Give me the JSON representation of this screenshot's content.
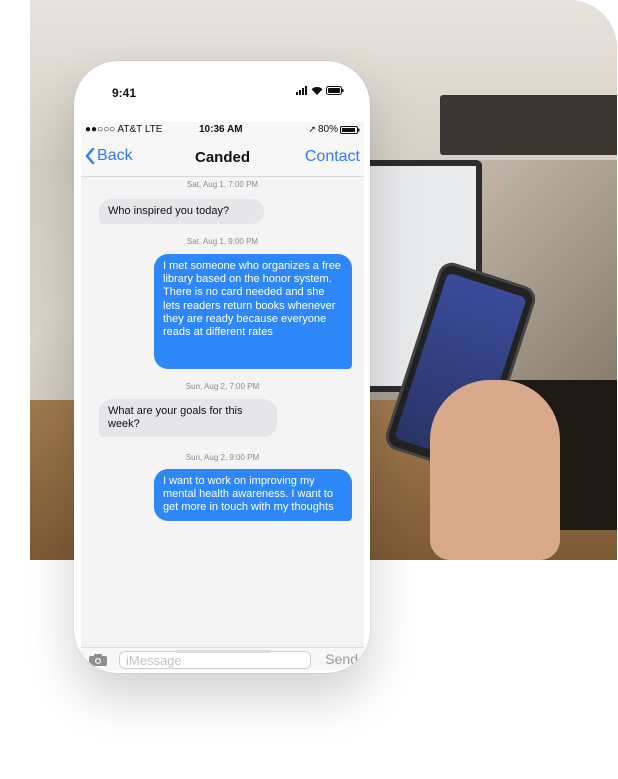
{
  "phone": {
    "time": "9:41"
  },
  "inner_status": {
    "carrier": "●●○○○ AT&T LTE",
    "time": "10:36 AM",
    "battery": "80%"
  },
  "navbar": {
    "back_label": "Back",
    "title": "Canded",
    "contact_label": "Contact"
  },
  "messages": [
    {
      "type": "timestamp",
      "text": "Sat, Aug 1, 7:00 PM"
    },
    {
      "type": "received",
      "text": "Who inspired you today?"
    },
    {
      "type": "timestamp",
      "text": "Sat, Aug 1, 9:00 PM"
    },
    {
      "type": "sent",
      "text": "I met someone who organizes a free library based on the honor system. There is no card needed and she lets readers return books whenever they are ready because everyone reads at different rates"
    },
    {
      "type": "timestamp",
      "text": "Sun, Aug 2, 7:00 PM"
    },
    {
      "type": "received",
      "text": "What are your goals for this week?"
    },
    {
      "type": "timestamp",
      "text": "Sun, Aug 2, 9:00 PM"
    },
    {
      "type": "sent",
      "text": "I want to work on improving my mental health awareness. I want to get more in touch with my thoughts"
    }
  ],
  "input_bar": {
    "placeholder": "iMessage",
    "send_label": "Send"
  },
  "colors": {
    "ios_blue": "#2e87f6",
    "received_bubble": "#e5e5ea"
  }
}
